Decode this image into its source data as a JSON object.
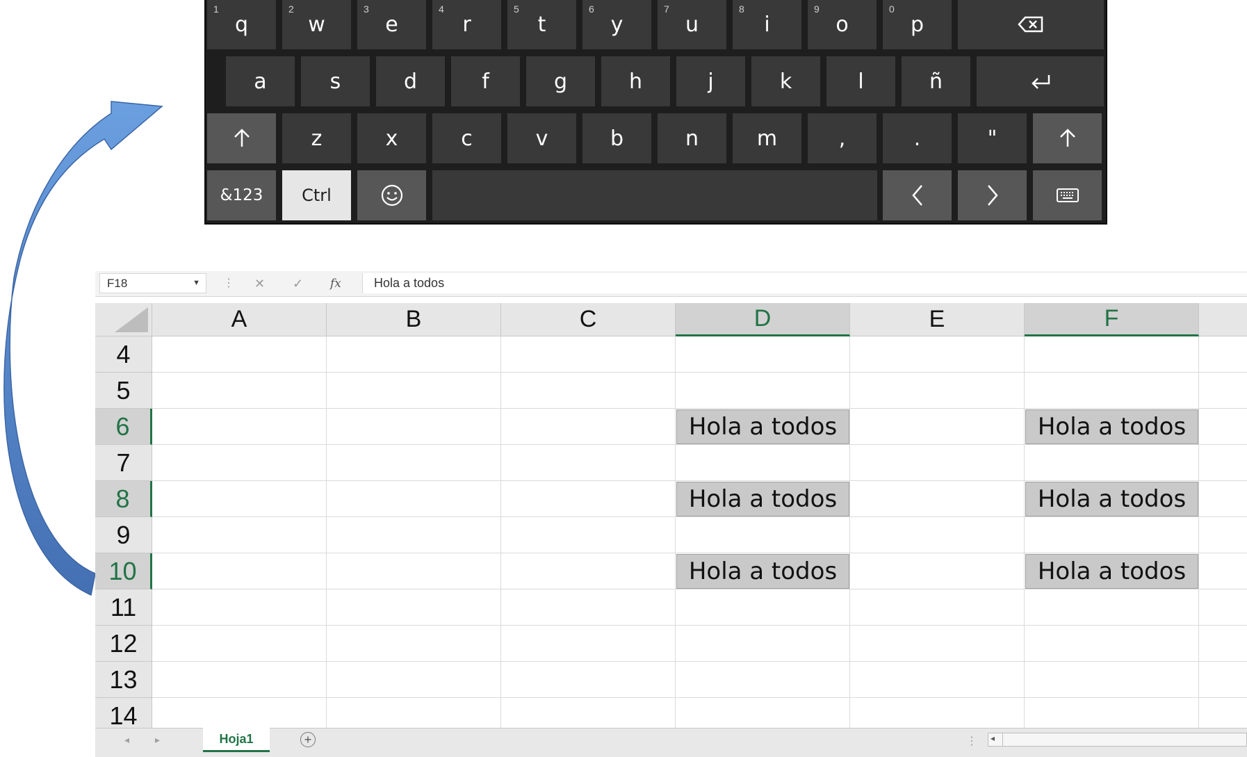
{
  "keyboard": {
    "row1": [
      {
        "hint": "1",
        "key": "q"
      },
      {
        "hint": "2",
        "key": "w"
      },
      {
        "hint": "3",
        "key": "e"
      },
      {
        "hint": "4",
        "key": "r"
      },
      {
        "hint": "5",
        "key": "t"
      },
      {
        "hint": "6",
        "key": "y"
      },
      {
        "hint": "7",
        "key": "u"
      },
      {
        "hint": "8",
        "key": "i"
      },
      {
        "hint": "9",
        "key": "o"
      },
      {
        "hint": "0",
        "key": "p"
      }
    ],
    "row2": [
      "a",
      "s",
      "d",
      "f",
      "g",
      "h",
      "j",
      "k",
      "l",
      "ñ"
    ],
    "row3": [
      "z",
      "x",
      "c",
      "v",
      "b",
      "n",
      "m",
      ",",
      ".",
      "\""
    ],
    "symbols_label": "&123",
    "ctrl_label": "Ctrl",
    "icons": {
      "backspace": "backspace-icon",
      "enter": "enter-icon",
      "shift": "shift-icon",
      "emoji": "emoji-icon",
      "left": "chevron-left-icon",
      "right": "chevron-right-icon",
      "keyboard": "keyboard-icon"
    }
  },
  "excel": {
    "name_box": "F18",
    "formula": "Hola a todos",
    "columns": [
      "A",
      "B",
      "C",
      "D",
      "E",
      "F"
    ],
    "selected_columns": [
      "D",
      "F"
    ],
    "rows": [
      "4",
      "5",
      "6",
      "7",
      "8",
      "9",
      "10",
      "11",
      "12",
      "13",
      "14"
    ],
    "selected_rows": [
      "6",
      "8",
      "10"
    ],
    "filled_cells": [
      {
        "row": "6",
        "col": "D",
        "value": "Hola a todos"
      },
      {
        "row": "6",
        "col": "F",
        "value": "Hola a todos"
      },
      {
        "row": "8",
        "col": "D",
        "value": "Hola a todos"
      },
      {
        "row": "8",
        "col": "F",
        "value": "Hola a todos"
      },
      {
        "row": "10",
        "col": "D",
        "value": "Hola a todos"
      },
      {
        "row": "10",
        "col": "F",
        "value": "Hola a todos"
      }
    ],
    "sheet_tab": "Hoja1",
    "accent_color": "#217346"
  },
  "arrow": {
    "color": "#5b8fd1"
  }
}
